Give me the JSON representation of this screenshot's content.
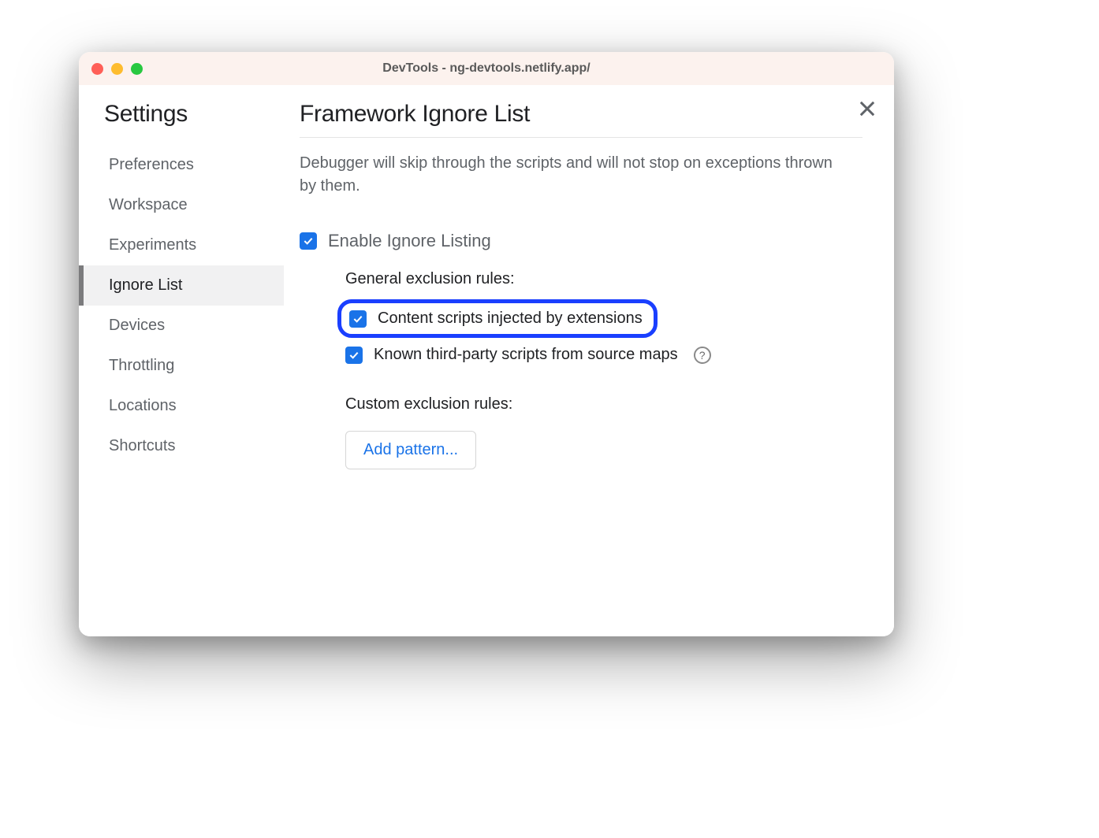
{
  "window": {
    "title": "DevTools - ng-devtools.netlify.app/"
  },
  "sidebar": {
    "title": "Settings",
    "items": [
      {
        "label": "Preferences",
        "selected": false
      },
      {
        "label": "Workspace",
        "selected": false
      },
      {
        "label": "Experiments",
        "selected": false
      },
      {
        "label": "Ignore List",
        "selected": true
      },
      {
        "label": "Devices",
        "selected": false
      },
      {
        "label": "Throttling",
        "selected": false
      },
      {
        "label": "Locations",
        "selected": false
      },
      {
        "label": "Shortcuts",
        "selected": false
      }
    ]
  },
  "main": {
    "title": "Framework Ignore List",
    "description": "Debugger will skip through the scripts and will not stop on exceptions thrown by them.",
    "enable_checkbox": {
      "label": "Enable Ignore Listing",
      "checked": true
    },
    "general_rules_heading": "General exclusion rules:",
    "general_rules": [
      {
        "label": "Content scripts injected by extensions",
        "checked": true,
        "highlighted": true,
        "help": false
      },
      {
        "label": "Known third-party scripts from source maps",
        "checked": true,
        "highlighted": false,
        "help": true
      }
    ],
    "custom_rules_heading": "Custom exclusion rules:",
    "add_pattern_label": "Add pattern..."
  }
}
